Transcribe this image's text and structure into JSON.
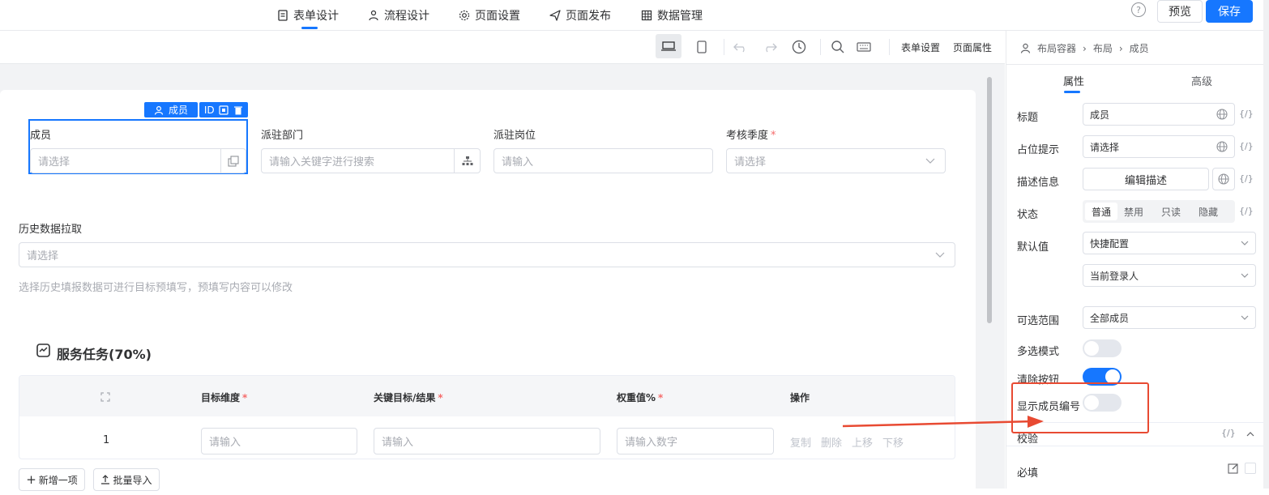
{
  "nav": {
    "tabs": [
      {
        "label": "表单设计"
      },
      {
        "label": "流程设计"
      },
      {
        "label": "页面设置"
      },
      {
        "label": "页面发布"
      },
      {
        "label": "数据管理"
      }
    ],
    "help_label": "?",
    "preview_label": "预览",
    "save_label": "保存"
  },
  "toolbar": {
    "form_settings": "表单设置",
    "page_props": "页面属性"
  },
  "form": {
    "selected_tag": "成员",
    "id_tag": "ID",
    "fields": [
      {
        "label": "成员",
        "placeholder": "请选择"
      },
      {
        "label": "派驻部门",
        "placeholder": "请输入关键字进行搜索"
      },
      {
        "label": "派驻岗位",
        "placeholder": "请输入"
      },
      {
        "label": "考核季度",
        "placeholder": "请选择",
        "required": "*"
      }
    ],
    "history": {
      "label": "历史数据拉取",
      "placeholder": "请选择",
      "hint": "选择历史填报数据可进行目标预填写，预填写内容可以修改"
    },
    "section_title": "服务任务(70%)",
    "table": {
      "headers": [
        "目标维度",
        "关键目标/结果",
        "权重值%",
        "操作"
      ],
      "required": "*",
      "row_index": "1",
      "placeholders": [
        "请输入",
        "请输入",
        "请输入数字"
      ],
      "ops": [
        "复制",
        "删除",
        "上移",
        "下移"
      ]
    },
    "add_item": "新增一项",
    "batch_import": "批量导入"
  },
  "panel": {
    "breadcrumb": [
      "布局容器",
      "布局",
      "成员"
    ],
    "tabs": [
      "属性",
      "高级"
    ],
    "code_label": "{/}",
    "title_label": "标题",
    "title_value": "成员",
    "placeholder_label": "占位提示",
    "placeholder_value": "请选择",
    "desc_label": "描述信息",
    "desc_button": "编辑描述",
    "status_label": "状态",
    "status_options": [
      "普通",
      "禁用",
      "只读",
      "隐藏"
    ],
    "default_label": "默认值",
    "default_value": "快捷配置",
    "default_value2": "当前登录人",
    "range_label": "可选范围",
    "range_value": "全部成员",
    "multi_label": "多选模式",
    "multi_on": false,
    "clear_label": "清除按钮",
    "clear_on": true,
    "show_id_label": "显示成员编号",
    "show_id_on": false,
    "validate_label": "校验",
    "required_label": "必填"
  },
  "colors": {
    "accent": "#1677ff",
    "annotation": "#e84a32"
  }
}
